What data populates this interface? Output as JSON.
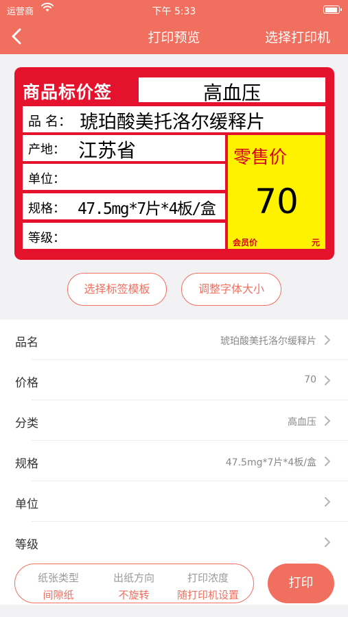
{
  "status_bar": {
    "carrier": "运营商",
    "time": "下午 5:33"
  },
  "navbar": {
    "title": "打印预览",
    "right_action": "选择打印机"
  },
  "label_preview": {
    "tag_title": "商品标价签",
    "category": "高血压",
    "name_key": "品 名：",
    "name_value": "琥珀酸美托洛尔缓释片",
    "origin_key": "产地：",
    "origin_value": "江苏省",
    "unit_key": "单位：",
    "unit_value": "",
    "spec_key": "规格：",
    "spec_value": "47.5mg*7片*4板/盒",
    "grade_key": "等级：",
    "grade_value": "",
    "retail_label": "零售价",
    "price": "70",
    "member_price_label": "会员价",
    "currency_unit": "元"
  },
  "actions": {
    "template_button": "选择标签模板",
    "font_button": "调整字体大小"
  },
  "form_rows": [
    {
      "label": "品名",
      "value": "琥珀酸美托洛尔缓释片"
    },
    {
      "label": "价格",
      "value": "70"
    },
    {
      "label": "分类",
      "value": "高血压"
    },
    {
      "label": "规格",
      "value": "47.5mg*7片*4板/盒"
    },
    {
      "label": "单位",
      "value": ""
    },
    {
      "label": "等级",
      "value": ""
    }
  ],
  "bottom_bar": {
    "paper_type_label": "纸张类型",
    "paper_type_value": "间隙纸",
    "direction_label": "出纸方向",
    "direction_value": "不旋转",
    "density_label": "打印浓度",
    "density_value": "随打印机设置",
    "print_button": "打印"
  },
  "colors": {
    "accent": "#f16f5e",
    "label_red": "#e4122d",
    "price_yellow": "#fff200"
  },
  "icons": {
    "back": "chevron-left-icon",
    "row_arrow": "chevron-right-icon",
    "wifi": "wifi-icon",
    "battery": "battery-icon"
  }
}
